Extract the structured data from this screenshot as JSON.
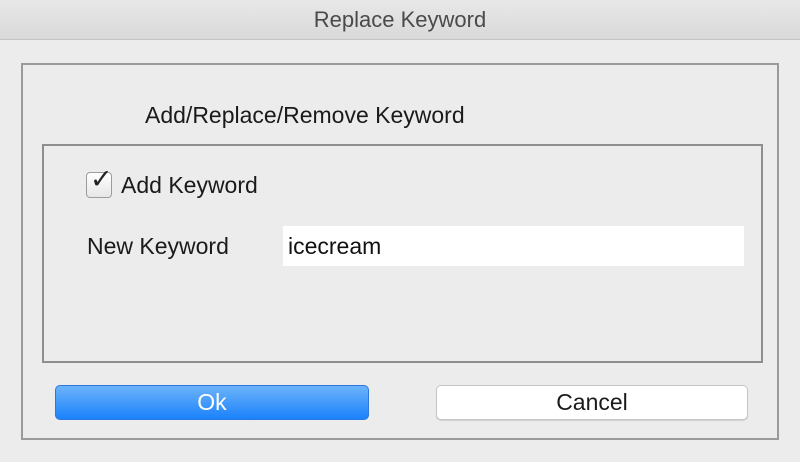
{
  "window": {
    "title": "Replace Keyword"
  },
  "group": {
    "title": "Add/Replace/Remove Keyword"
  },
  "add_keyword": {
    "label": "Add Keyword",
    "checked": true
  },
  "new_keyword": {
    "label": "New Keyword",
    "value": "icecream"
  },
  "buttons": {
    "ok_label": "Ok",
    "cancel_label": "Cancel"
  },
  "colors": {
    "window_bg": "#ececec",
    "accent": "#1a82fb",
    "border": "#9a9a9a"
  }
}
